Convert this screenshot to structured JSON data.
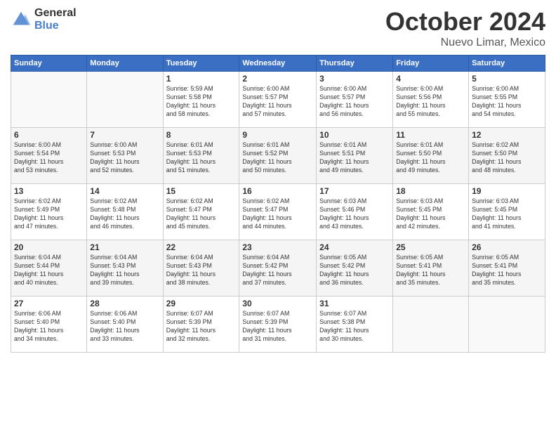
{
  "header": {
    "logo_general": "General",
    "logo_blue": "Blue",
    "month_title": "October 2024",
    "location": "Nuevo Limar, Mexico"
  },
  "weekdays": [
    "Sunday",
    "Monday",
    "Tuesday",
    "Wednesday",
    "Thursday",
    "Friday",
    "Saturday"
  ],
  "rows": [
    [
      {
        "day": "",
        "empty": true
      },
      {
        "day": "",
        "empty": true
      },
      {
        "day": "1",
        "line1": "Sunrise: 5:59 AM",
        "line2": "Sunset: 5:58 PM",
        "line3": "Daylight: 11 hours",
        "line4": "and 58 minutes."
      },
      {
        "day": "2",
        "line1": "Sunrise: 6:00 AM",
        "line2": "Sunset: 5:57 PM",
        "line3": "Daylight: 11 hours",
        "line4": "and 57 minutes."
      },
      {
        "day": "3",
        "line1": "Sunrise: 6:00 AM",
        "line2": "Sunset: 5:57 PM",
        "line3": "Daylight: 11 hours",
        "line4": "and 56 minutes."
      },
      {
        "day": "4",
        "line1": "Sunrise: 6:00 AM",
        "line2": "Sunset: 5:56 PM",
        "line3": "Daylight: 11 hours",
        "line4": "and 55 minutes."
      },
      {
        "day": "5",
        "line1": "Sunrise: 6:00 AM",
        "line2": "Sunset: 5:55 PM",
        "line3": "Daylight: 11 hours",
        "line4": "and 54 minutes."
      }
    ],
    [
      {
        "day": "6",
        "line1": "Sunrise: 6:00 AM",
        "line2": "Sunset: 5:54 PM",
        "line3": "Daylight: 11 hours",
        "line4": "and 53 minutes."
      },
      {
        "day": "7",
        "line1": "Sunrise: 6:00 AM",
        "line2": "Sunset: 5:53 PM",
        "line3": "Daylight: 11 hours",
        "line4": "and 52 minutes."
      },
      {
        "day": "8",
        "line1": "Sunrise: 6:01 AM",
        "line2": "Sunset: 5:53 PM",
        "line3": "Daylight: 11 hours",
        "line4": "and 51 minutes."
      },
      {
        "day": "9",
        "line1": "Sunrise: 6:01 AM",
        "line2": "Sunset: 5:52 PM",
        "line3": "Daylight: 11 hours",
        "line4": "and 50 minutes."
      },
      {
        "day": "10",
        "line1": "Sunrise: 6:01 AM",
        "line2": "Sunset: 5:51 PM",
        "line3": "Daylight: 11 hours",
        "line4": "and 49 minutes."
      },
      {
        "day": "11",
        "line1": "Sunrise: 6:01 AM",
        "line2": "Sunset: 5:50 PM",
        "line3": "Daylight: 11 hours",
        "line4": "and 49 minutes."
      },
      {
        "day": "12",
        "line1": "Sunrise: 6:02 AM",
        "line2": "Sunset: 5:50 PM",
        "line3": "Daylight: 11 hours",
        "line4": "and 48 minutes."
      }
    ],
    [
      {
        "day": "13",
        "line1": "Sunrise: 6:02 AM",
        "line2": "Sunset: 5:49 PM",
        "line3": "Daylight: 11 hours",
        "line4": "and 47 minutes."
      },
      {
        "day": "14",
        "line1": "Sunrise: 6:02 AM",
        "line2": "Sunset: 5:48 PM",
        "line3": "Daylight: 11 hours",
        "line4": "and 46 minutes."
      },
      {
        "day": "15",
        "line1": "Sunrise: 6:02 AM",
        "line2": "Sunset: 5:47 PM",
        "line3": "Daylight: 11 hours",
        "line4": "and 45 minutes."
      },
      {
        "day": "16",
        "line1": "Sunrise: 6:02 AM",
        "line2": "Sunset: 5:47 PM",
        "line3": "Daylight: 11 hours",
        "line4": "and 44 minutes."
      },
      {
        "day": "17",
        "line1": "Sunrise: 6:03 AM",
        "line2": "Sunset: 5:46 PM",
        "line3": "Daylight: 11 hours",
        "line4": "and 43 minutes."
      },
      {
        "day": "18",
        "line1": "Sunrise: 6:03 AM",
        "line2": "Sunset: 5:45 PM",
        "line3": "Daylight: 11 hours",
        "line4": "and 42 minutes."
      },
      {
        "day": "19",
        "line1": "Sunrise: 6:03 AM",
        "line2": "Sunset: 5:45 PM",
        "line3": "Daylight: 11 hours",
        "line4": "and 41 minutes."
      }
    ],
    [
      {
        "day": "20",
        "line1": "Sunrise: 6:04 AM",
        "line2": "Sunset: 5:44 PM",
        "line3": "Daylight: 11 hours",
        "line4": "and 40 minutes."
      },
      {
        "day": "21",
        "line1": "Sunrise: 6:04 AM",
        "line2": "Sunset: 5:43 PM",
        "line3": "Daylight: 11 hours",
        "line4": "and 39 minutes."
      },
      {
        "day": "22",
        "line1": "Sunrise: 6:04 AM",
        "line2": "Sunset: 5:43 PM",
        "line3": "Daylight: 11 hours",
        "line4": "and 38 minutes."
      },
      {
        "day": "23",
        "line1": "Sunrise: 6:04 AM",
        "line2": "Sunset: 5:42 PM",
        "line3": "Daylight: 11 hours",
        "line4": "and 37 minutes."
      },
      {
        "day": "24",
        "line1": "Sunrise: 6:05 AM",
        "line2": "Sunset: 5:42 PM",
        "line3": "Daylight: 11 hours",
        "line4": "and 36 minutes."
      },
      {
        "day": "25",
        "line1": "Sunrise: 6:05 AM",
        "line2": "Sunset: 5:41 PM",
        "line3": "Daylight: 11 hours",
        "line4": "and 35 minutes."
      },
      {
        "day": "26",
        "line1": "Sunrise: 6:05 AM",
        "line2": "Sunset: 5:41 PM",
        "line3": "Daylight: 11 hours",
        "line4": "and 35 minutes."
      }
    ],
    [
      {
        "day": "27",
        "line1": "Sunrise: 6:06 AM",
        "line2": "Sunset: 5:40 PM",
        "line3": "Daylight: 11 hours",
        "line4": "and 34 minutes."
      },
      {
        "day": "28",
        "line1": "Sunrise: 6:06 AM",
        "line2": "Sunset: 5:40 PM",
        "line3": "Daylight: 11 hours",
        "line4": "and 33 minutes."
      },
      {
        "day": "29",
        "line1": "Sunrise: 6:07 AM",
        "line2": "Sunset: 5:39 PM",
        "line3": "Daylight: 11 hours",
        "line4": "and 32 minutes."
      },
      {
        "day": "30",
        "line1": "Sunrise: 6:07 AM",
        "line2": "Sunset: 5:39 PM",
        "line3": "Daylight: 11 hours",
        "line4": "and 31 minutes."
      },
      {
        "day": "31",
        "line1": "Sunrise: 6:07 AM",
        "line2": "Sunset: 5:38 PM",
        "line3": "Daylight: 11 hours",
        "line4": "and 30 minutes."
      },
      {
        "day": "",
        "empty": true
      },
      {
        "day": "",
        "empty": true
      }
    ]
  ]
}
